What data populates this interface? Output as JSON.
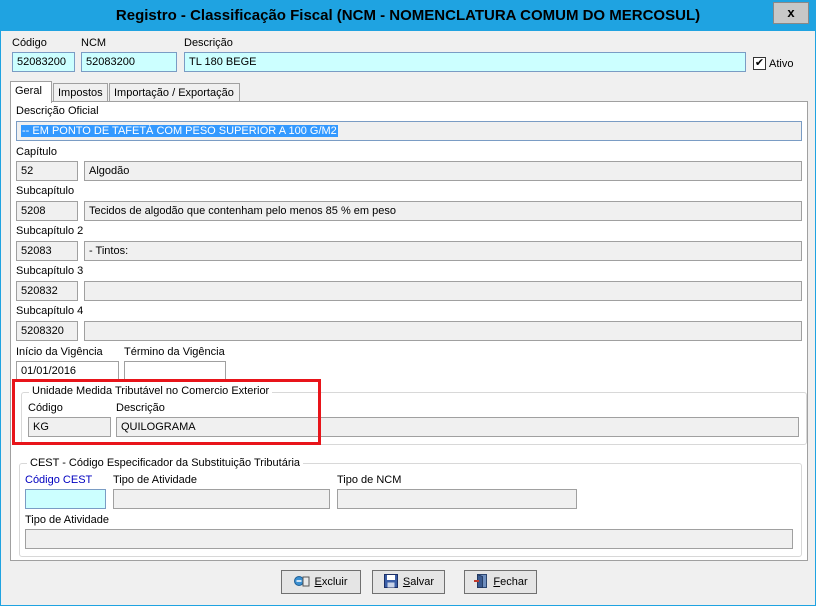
{
  "window": {
    "title": "Registro - Classificação Fiscal (NCM - NOMENCLATURA COMUM DO MERCOSUL)",
    "close_glyph": "x"
  },
  "header": {
    "codigo_label": "Código",
    "codigo_value": "52083200",
    "ncm_label": "NCM",
    "ncm_value": "52083200",
    "descricao_label": "Descrição",
    "descricao_value": "TL 180 BEGE",
    "ativo_label": "Ativo",
    "ativo_checked": "✔"
  },
  "tabs": [
    {
      "label": "Geral",
      "active": true
    },
    {
      "label": "Impostos",
      "active": false
    },
    {
      "label": "Importação / Exportação",
      "active": false
    }
  ],
  "geral": {
    "descricao_oficial_label": "Descrição Oficial",
    "descricao_oficial_value": "-- EM PONTO DE TAFETÁ COM PESO SUPERIOR A 100 G/M2",
    "capitulo": {
      "label": "Capítulo",
      "code": "52",
      "desc": "Algodão"
    },
    "subcapitulo": {
      "label": "Subcapítulo",
      "code": "5208",
      "desc": "Tecidos de algodão que contenham pelo menos 85 % em peso"
    },
    "subcapitulo2": {
      "label": "Subcapítulo 2",
      "code": "52083",
      "desc": "- Tintos:"
    },
    "subcapitulo3": {
      "label": "Subcapítulo 3",
      "code": "520832",
      "desc": ""
    },
    "subcapitulo4": {
      "label": "Subcapítulo 4",
      "code": "5208320",
      "desc": ""
    },
    "inicio_label": "Início da Vigência",
    "inicio_value": "01/01/2016",
    "termino_label": "Término da Vigência",
    "termino_value": ""
  },
  "unidade": {
    "group_title": "Unidade Medida Tributável  no Comercio Exterior",
    "codigo_label": "Código",
    "codigo_value": "KG",
    "descricao_label": "Descrição",
    "descricao_value": "QUILOGRAMA"
  },
  "cest": {
    "group_title": "CEST - Código Especificador da Substituição Tributária",
    "codigo_label": "Código CEST",
    "codigo_value": "",
    "tipo_atividade_label": "Tipo de Atividade",
    "tipo_atividade_value": "",
    "tipo_ncm_label": "Tipo de NCM",
    "tipo_ncm_value": "",
    "tipo_atividade2_label": "Tipo de Atividade",
    "tipo_atividade2_value": ""
  },
  "buttons": {
    "excluir_first": "E",
    "excluir_rest": "xcluir",
    "salvar_first": "S",
    "salvar_rest": "alvar",
    "fechar_first": "F",
    "fechar_rest": "echar"
  },
  "colors": {
    "titlebar": "#1fa3e1",
    "highlight_box": "#e8141a",
    "cyan_field": "#ccffff",
    "cest_label": "#0000c0"
  }
}
